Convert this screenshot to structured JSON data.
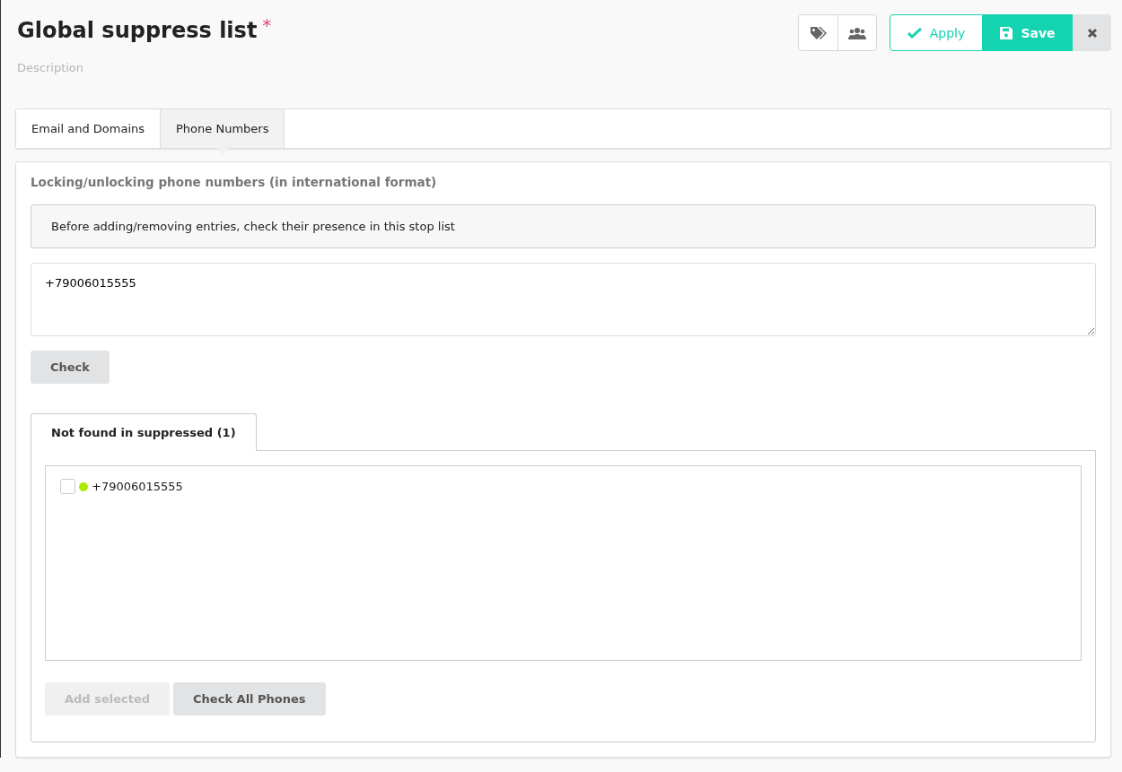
{
  "header": {
    "title": "Global suppress list",
    "required_mark": "*",
    "description_placeholder": "Description"
  },
  "toolbar": {
    "apply": "Apply",
    "save": "Save"
  },
  "tabs": [
    {
      "label": "Email and Domains",
      "selected": false
    },
    {
      "label": "Phone Numbers",
      "selected": true
    }
  ],
  "section": {
    "heading": "Locking/unlocking phone numbers (in international format)",
    "notice": "Before adding/removing entries, check their presence in this stop list",
    "input_value": "+79006015555",
    "check_button": "Check"
  },
  "result_tabs": [
    {
      "label": "Not found in suppressed (1)",
      "selected": true
    }
  ],
  "results": [
    {
      "phone": "+79006015555",
      "checked": false,
      "color": "#aeea00"
    }
  ],
  "actions": [
    {
      "label": "Add selected",
      "disabled": true
    },
    {
      "label": "Check All Phones",
      "disabled": false
    }
  ]
}
